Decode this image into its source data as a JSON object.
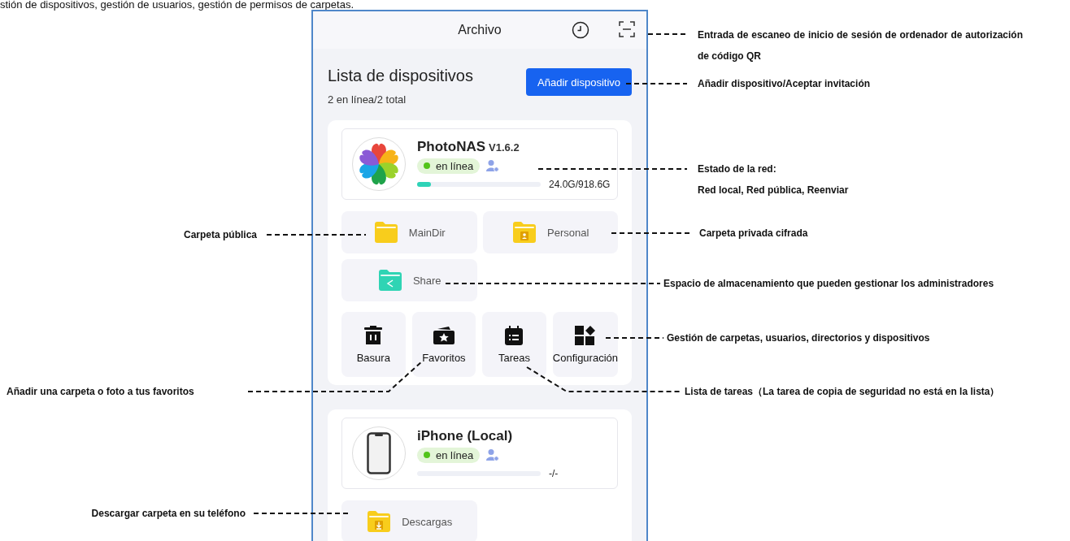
{
  "caption_top": "stión de dispositivos, gestión de usuarios, gestión de permisos de carpetas.",
  "app": {
    "header": {
      "title": "Archivo"
    },
    "device_list": {
      "title": "Lista de dispositivos",
      "summary": "2 en línea/2 total",
      "add_button": "Añadir dispositivo"
    },
    "devices": [
      {
        "name": "PhotoNAS",
        "version": "V1.6.2",
        "kind": "nas",
        "online": true,
        "status": "en línea",
        "level": 0.11,
        "storage": "24.0G/918.6G",
        "folders": [
          {
            "label": "MainDir",
            "kind": "plain"
          },
          {
            "label": "Personal",
            "kind": "private"
          },
          {
            "label": "Share",
            "kind": "share"
          }
        ],
        "tools": [
          {
            "label": "Basura",
            "kind": "trash"
          },
          {
            "label": "Favoritos",
            "kind": "favorites"
          },
          {
            "label": "Tareas",
            "kind": "tasks"
          },
          {
            "label": "Configuración",
            "kind": "settings"
          }
        ]
      },
      {
        "name": "iPhone (Local)",
        "kind": "phone",
        "online": true,
        "status": "en línea",
        "level": 0,
        "storage": "-/-",
        "folders": [
          {
            "label": "Descargas",
            "kind": "download"
          }
        ]
      }
    ]
  },
  "annotations": [
    {
      "text": "Entrada de escaneo de inicio de sesión de ordenador de autorización de código QR"
    },
    {
      "text": "Añadir dispositivo/Aceptar invitación"
    },
    {
      "text": "Estado de la red:",
      "detail": "Red local, Red pública, Reenviar"
    },
    {
      "text": "Carpeta privada cifrada"
    },
    {
      "text": "Espacio de almacenamiento que pueden gestionar los administradores"
    },
    {
      "text": "Gestión de carpetas, usuarios, directorios y dispositivos"
    },
    {
      "text": "Carpeta pública"
    },
    {
      "text": "Añadir una carpeta o foto a tus favoritos"
    },
    {
      "text": "Lista de tareas（La tarea de copia de seguridad no está en la lista）"
    },
    {
      "text": "Descargar carpeta en su teléfono"
    }
  ]
}
